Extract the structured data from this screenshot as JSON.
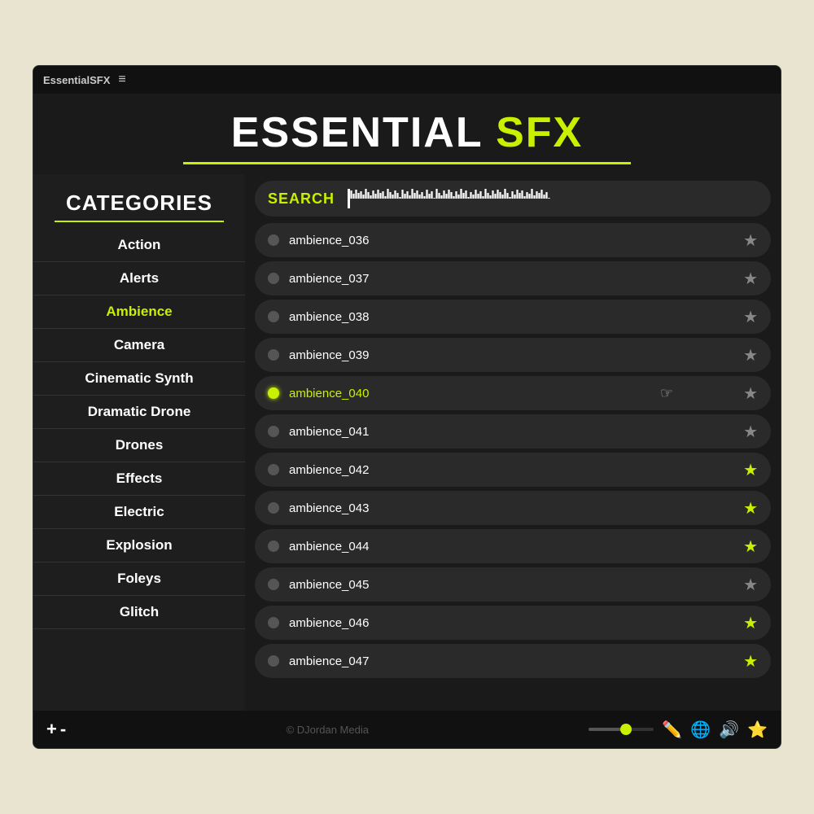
{
  "app": {
    "title": "EssentialSFX",
    "menu_icon": "≡"
  },
  "header": {
    "title_white": "ESSENTIAL",
    "title_yellow": "SFX"
  },
  "sidebar": {
    "categories_label": "CATEGORIES",
    "items": [
      {
        "label": "Action",
        "active": false
      },
      {
        "label": "Alerts",
        "active": false
      },
      {
        "label": "Ambience",
        "active": true
      },
      {
        "label": "Camera",
        "active": false
      },
      {
        "label": "Cinematic Synth",
        "active": false
      },
      {
        "label": "Dramatic Drone",
        "active": false
      },
      {
        "label": "Drones",
        "active": false
      },
      {
        "label": "Effects",
        "active": false
      },
      {
        "label": "Electric",
        "active": false
      },
      {
        "label": "Explosion",
        "active": false
      },
      {
        "label": "Foleys",
        "active": false
      },
      {
        "label": "Glitch",
        "active": false
      }
    ]
  },
  "search": {
    "label": "SEARCH"
  },
  "sounds": [
    {
      "name": "ambience_036",
      "playing": false,
      "starred": false
    },
    {
      "name": "ambience_037",
      "playing": false,
      "starred": false
    },
    {
      "name": "ambience_038",
      "playing": false,
      "starred": false
    },
    {
      "name": "ambience_039",
      "playing": false,
      "starred": false
    },
    {
      "name": "ambience_040",
      "playing": true,
      "starred": false,
      "cursor": true
    },
    {
      "name": "ambience_041",
      "playing": false,
      "starred": false
    },
    {
      "name": "ambience_042",
      "playing": false,
      "starred": true
    },
    {
      "name": "ambience_043",
      "playing": false,
      "starred": true
    },
    {
      "name": "ambience_044",
      "playing": false,
      "starred": true
    },
    {
      "name": "ambience_045",
      "playing": false,
      "starred": false
    },
    {
      "name": "ambience_046",
      "playing": false,
      "starred": true
    },
    {
      "name": "ambience_047",
      "playing": false,
      "starred": true
    }
  ],
  "bottom_bar": {
    "plus_label": "+",
    "minus_label": "-",
    "copyright": "© DJordan Media"
  },
  "colors": {
    "accent": "#c8f000",
    "bg_dark": "#1a1a1a",
    "bg_medium": "#2a2a2a"
  }
}
